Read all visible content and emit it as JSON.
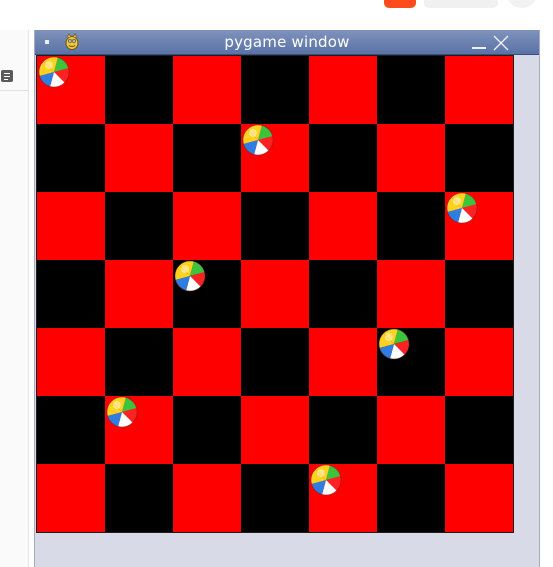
{
  "window": {
    "title": "pygame window"
  },
  "board": {
    "rows": 7,
    "cols": 7,
    "colors": {
      "light": "#ff0000",
      "dark": "#000000"
    },
    "balls": [
      {
        "row": 0,
        "col": 0
      },
      {
        "row": 1,
        "col": 3
      },
      {
        "row": 2,
        "col": 6
      },
      {
        "row": 3,
        "col": 2
      },
      {
        "row": 4,
        "col": 5
      },
      {
        "row": 5,
        "col": 1
      },
      {
        "row": 6,
        "col": 4
      }
    ]
  },
  "icons": {
    "app": "pygame-snake-icon",
    "minimize": "minimize-icon",
    "close": "close-icon",
    "menu": "window-menu-icon",
    "ball": "beach-ball-icon"
  }
}
